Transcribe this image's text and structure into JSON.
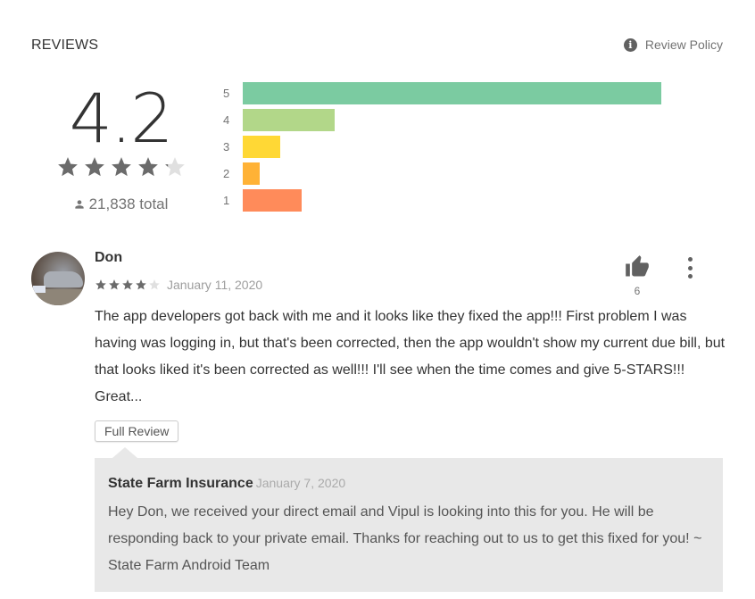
{
  "section": {
    "heading": "REVIEWS",
    "policy_label": "Review Policy",
    "policy_icon": "info-icon"
  },
  "summary": {
    "score": "4.2",
    "rating_value": 4.2,
    "rating_max": 5,
    "total_label": "21,838 total",
    "total_icon": "person-icon"
  },
  "chart_data": {
    "type": "bar",
    "orientation": "horizontal",
    "title": "",
    "categories": [
      "5",
      "4",
      "3",
      "2",
      "1"
    ],
    "values": [
      1.0,
      0.22,
      0.09,
      0.04,
      0.14
    ],
    "value_units": "relative share of largest bar",
    "colors": [
      "#7bcba1",
      "#b2d789",
      "#ffd835",
      "#ffb236",
      "#ff8b5a"
    ],
    "xlabel": "",
    "ylabel": "",
    "grid": false,
    "legend": "none"
  },
  "review": {
    "author": "Don",
    "rating": 4,
    "rating_max": 5,
    "date": "January 11, 2020",
    "helpful_count": "6",
    "text": "The app developers got back with me and it looks like they fixed the app!!! First problem I was having was logging in, but that's been corrected, then the app wouldn't show my current due bill, but that looks liked it's been corrected as well!!! I'll see when the time comes and give 5-STARS!!! Great...",
    "full_review_label": "Full Review",
    "reply": {
      "author": "State Farm Insurance",
      "date": "January 7, 2020",
      "text": "Hey Don, we received your direct email and Vipul is looking into this for you. He will be responding back to your private email. Thanks for reaching out to us to get this fixed for you! ~ State Farm Android Team"
    }
  }
}
